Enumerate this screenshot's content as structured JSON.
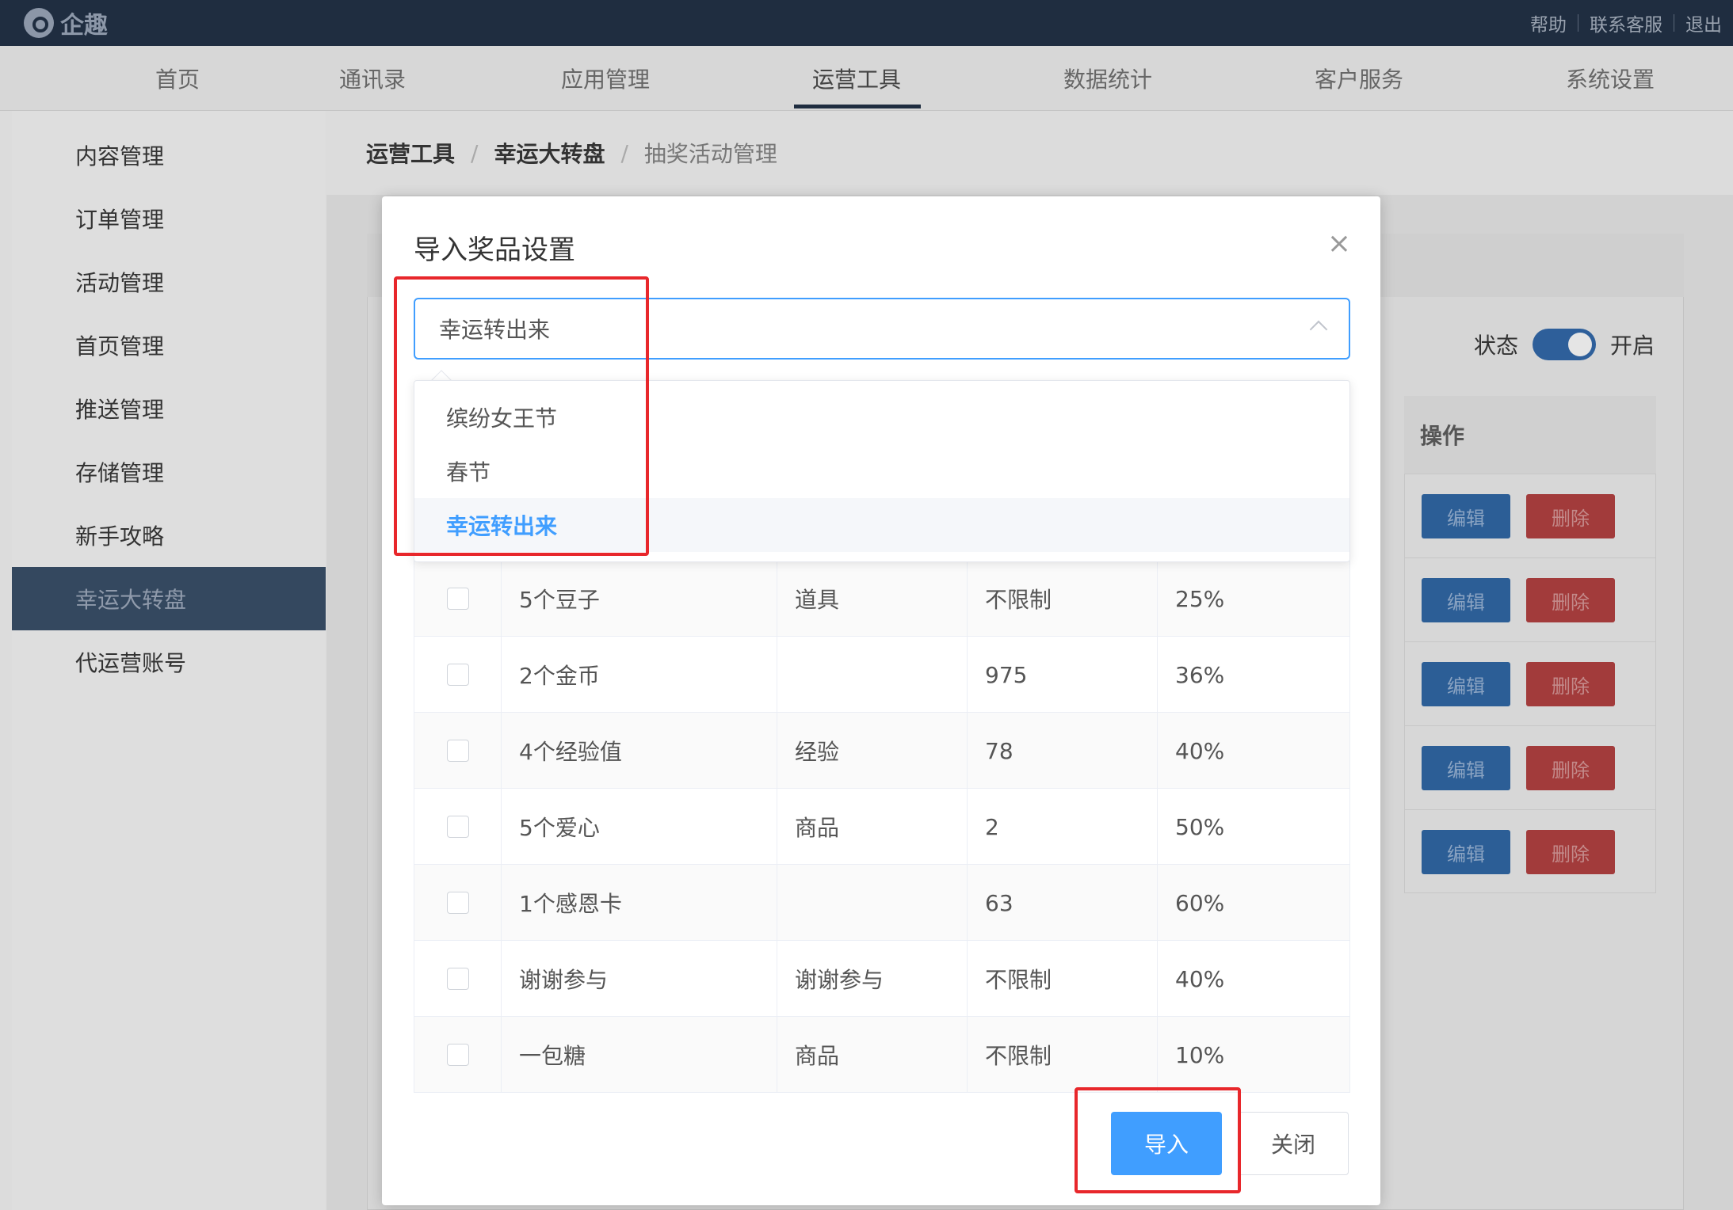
{
  "topbar": {
    "logo_text": "企趣",
    "links": [
      "帮助",
      "联系客服",
      "退出"
    ]
  },
  "nav": {
    "items": [
      "首页",
      "通讯录",
      "应用管理",
      "运营工具",
      "数据统计",
      "客户服务",
      "系统设置"
    ],
    "active": "运营工具"
  },
  "sidebar": {
    "items": [
      "内容管理",
      "订单管理",
      "活动管理",
      "首页管理",
      "推送管理",
      "存储管理",
      "新手攻略",
      "幸运大转盘",
      "代运营账号"
    ],
    "active": "幸运大转盘"
  },
  "breadcrumb": {
    "level1": "运营工具",
    "level2": "幸运大转盘",
    "level3": "抽奖活动管理",
    "separator": "/"
  },
  "background_page": {
    "status_label": "状态",
    "status_value": "开启",
    "ops_header": "操作",
    "edit_label": "编辑",
    "delete_label": "删除"
  },
  "modal": {
    "title": "导入奖品设置",
    "close_icon": "close-icon",
    "select_value": "幸运转出来",
    "options": [
      "缤纷女王节",
      "春节",
      "幸运转出来"
    ],
    "selected_option": "幸运转出来",
    "rows": [
      {
        "name": "5个豆子",
        "type": "道具",
        "limit": "不限制",
        "rate": "25%"
      },
      {
        "name": "2个金币",
        "type": "",
        "limit": "975",
        "rate": "36%"
      },
      {
        "name": "4个经验值",
        "type": "经验",
        "limit": "78",
        "rate": "40%"
      },
      {
        "name": "5个爱心",
        "type": "商品",
        "limit": "2",
        "rate": "50%"
      },
      {
        "name": "1个感恩卡",
        "type": "",
        "limit": "63",
        "rate": "60%"
      },
      {
        "name": "谢谢参与",
        "type": "谢谢参与",
        "limit": "不限制",
        "rate": "40%"
      },
      {
        "name": "一包糖",
        "type": "商品",
        "limit": "不限制",
        "rate": "10%"
      }
    ],
    "import_label": "导入",
    "close_label": "关闭"
  },
  "colors": {
    "topbar": "#1f2d40",
    "primary": "#409eff",
    "highlight": "#e8272b"
  }
}
